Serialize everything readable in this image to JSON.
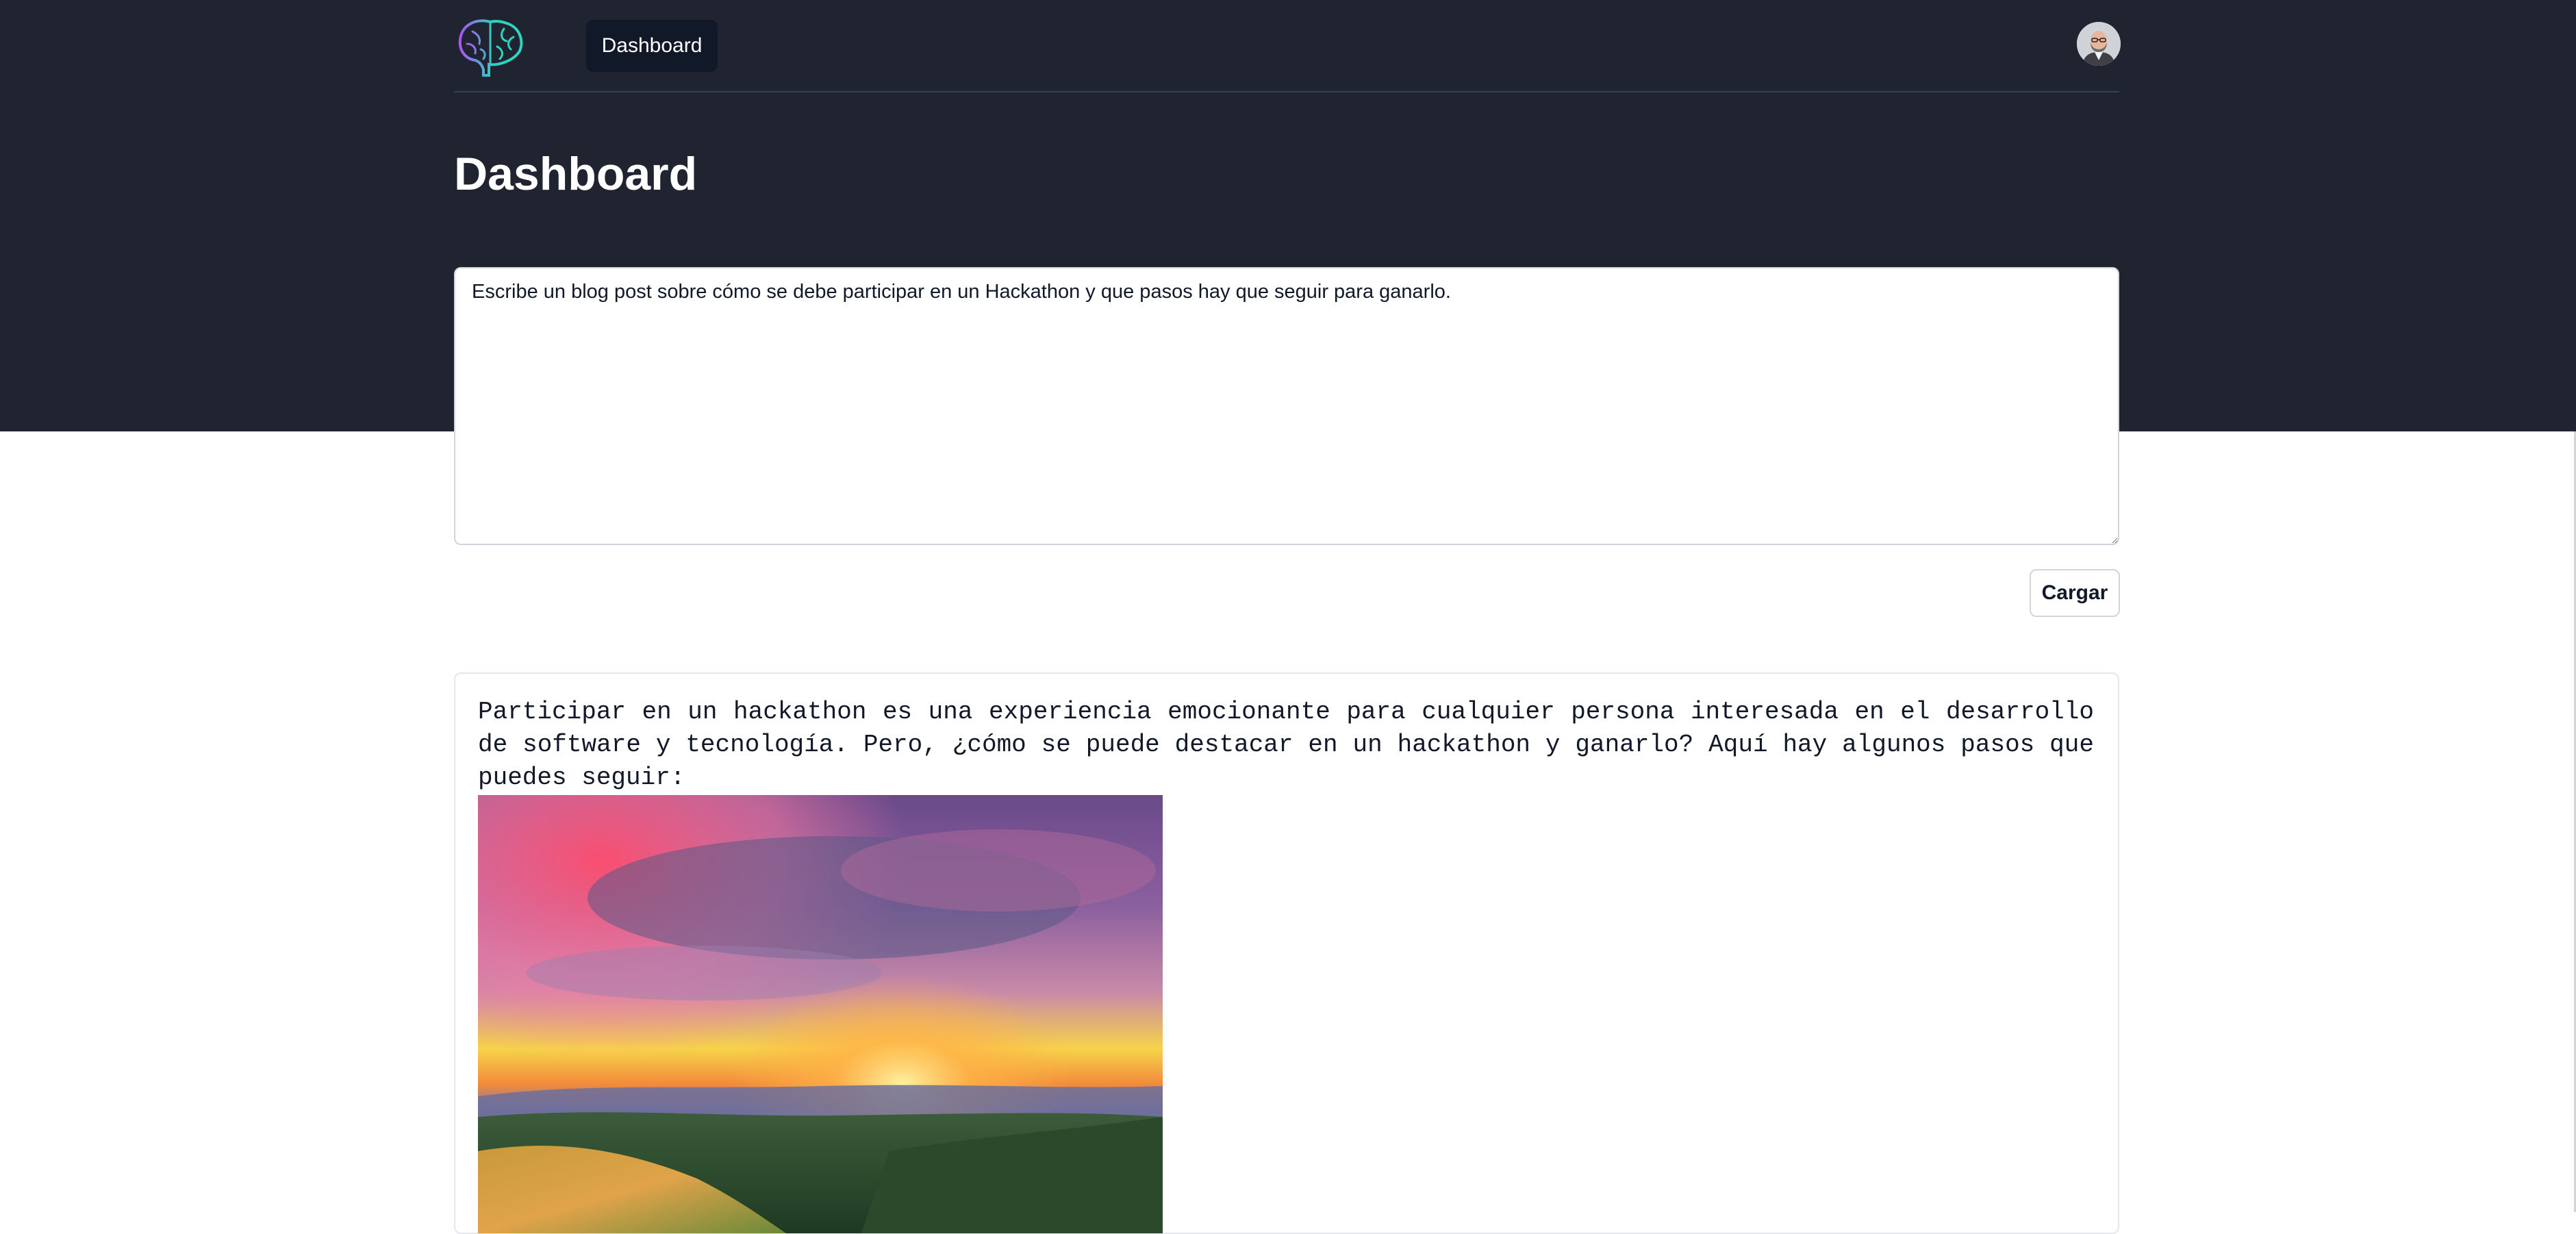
{
  "nav": {
    "items": [
      {
        "label": "Dashboard",
        "active": true
      }
    ]
  },
  "page": {
    "title": "Dashboard"
  },
  "prompt": {
    "value": "Escribe un blog post sobre cómo se debe participar en un Hackathon y que pasos hay que seguir para ganarlo."
  },
  "actions": {
    "load_label": "Cargar"
  },
  "result": {
    "text": "Participar en un hackathon es una experiencia emocionante para cualquier persona interesada en el desarrollo de software y tecnología. Pero, ¿cómo se puede destacar en un hackathon y ganarlo? Aquí hay algunos pasos que puedes seguir:"
  },
  "icons": {
    "logo": "brain-logo-icon",
    "avatar": "user-avatar"
  },
  "colors": {
    "header_bg": "#1f2430",
    "nav_active_bg": "#111827",
    "logo_teal": "#2dd4bf",
    "logo_purple": "#a855f7"
  }
}
